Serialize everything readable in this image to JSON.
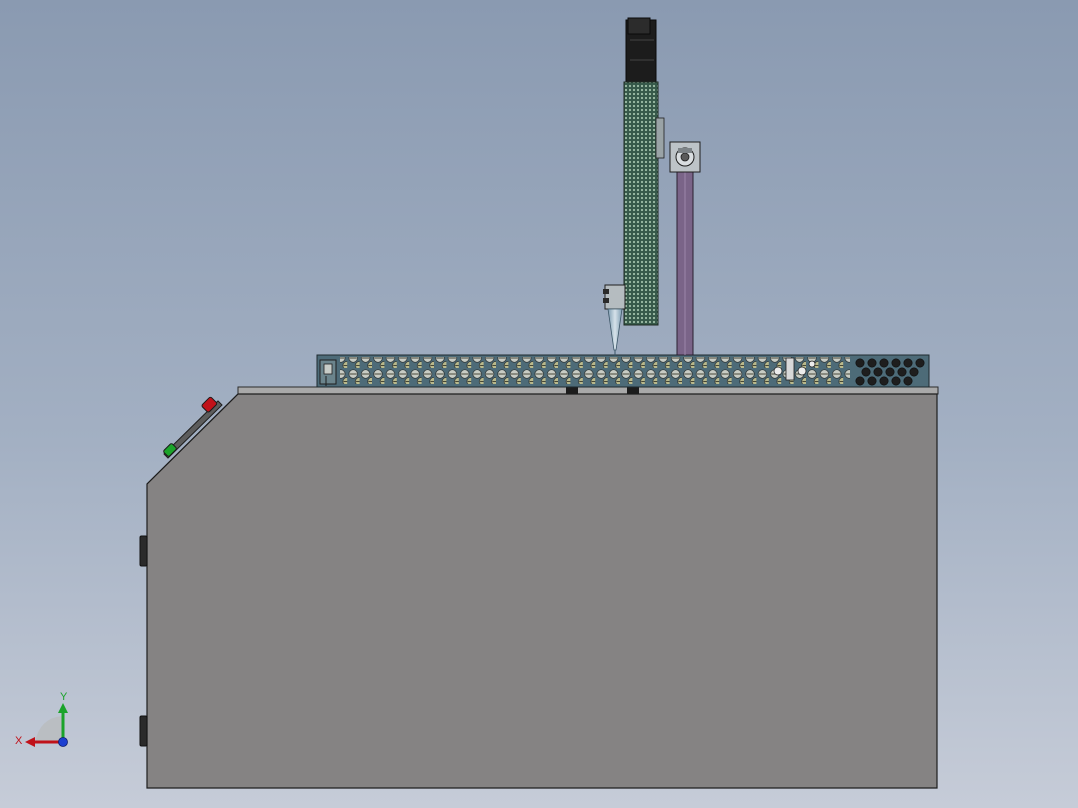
{
  "viewport": {
    "background_top": "#8a9ab1",
    "background_bottom": "#c6ccd8"
  },
  "model": {
    "cabinet_color": "#858383",
    "plate_color": "#4d6b78",
    "actuator_color": "#36594a",
    "post_color": "#7a6488",
    "motor_color": "#1c1c1c"
  },
  "triad": {
    "x_label": "X",
    "y_label": "Y",
    "x_color": "#c0121a",
    "y_color": "#1aa32a",
    "z_color": "#1c3fd0"
  }
}
